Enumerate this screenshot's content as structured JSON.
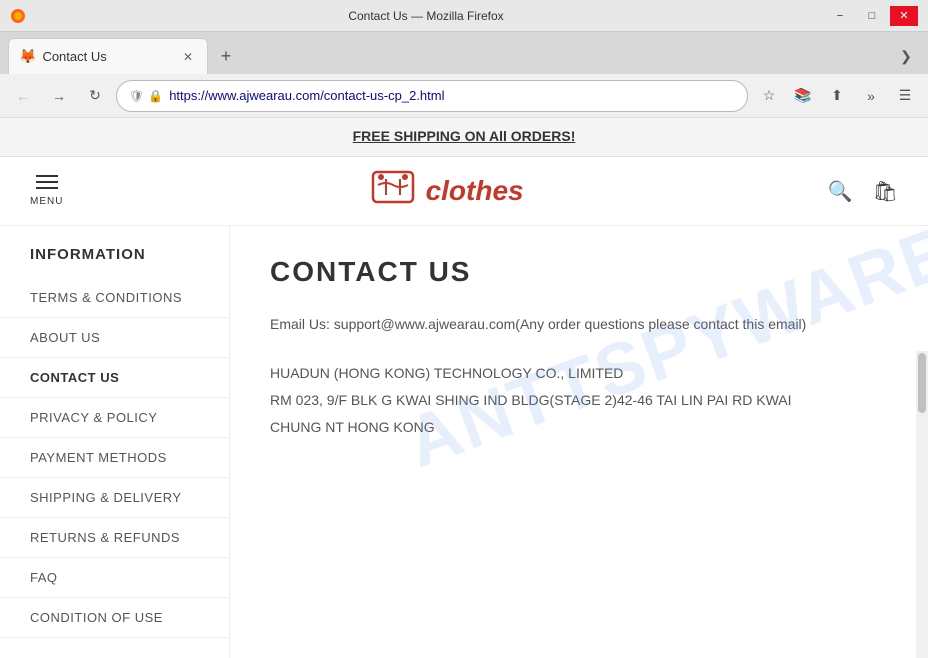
{
  "browser": {
    "title": "Contact Us — Mozilla Firefox",
    "tab_title": "Contact Us",
    "url": "https://www.ajwearau.com/contact-us-cp_2.html",
    "new_tab_label": "+",
    "chevron": "❯"
  },
  "banner": {
    "text": "FREE SHIPPING ON All ORDERS!"
  },
  "header": {
    "menu_label": "MENU",
    "logo_text": "clothes"
  },
  "sidebar": {
    "title": "INFORMATION",
    "items": [
      {
        "label": "TERMS & CONDITIONS",
        "active": false
      },
      {
        "label": "ABOUT US",
        "active": false
      },
      {
        "label": "CONTACT US",
        "active": true
      },
      {
        "label": "PRIVACY & POLICY",
        "active": false
      },
      {
        "label": "PAYMENT METHODS",
        "active": false
      },
      {
        "label": "SHIPPING & DELIVERY",
        "active": false
      },
      {
        "label": "RETURNS & REFUNDS",
        "active": false
      },
      {
        "label": "FAQ",
        "active": false
      },
      {
        "label": "CONDITION OF USE",
        "active": false
      }
    ]
  },
  "content": {
    "page_title": "CONTACT US",
    "email_line": "Email Us: support@www.ajwearau.com(Any order questions please contact this email)",
    "company_name": "HUADUN (HONG KONG) TECHNOLOGY CO., LIMITED",
    "address_line1": "RM 023, 9/F BLK G KWAI SHING IND BLDG(STAGE 2)42-46 TAI LIN PAI RD KWAI",
    "address_line2": "CHUNG NT HONG KONG"
  },
  "watermark": "ANTTSPYWARE.COM"
}
